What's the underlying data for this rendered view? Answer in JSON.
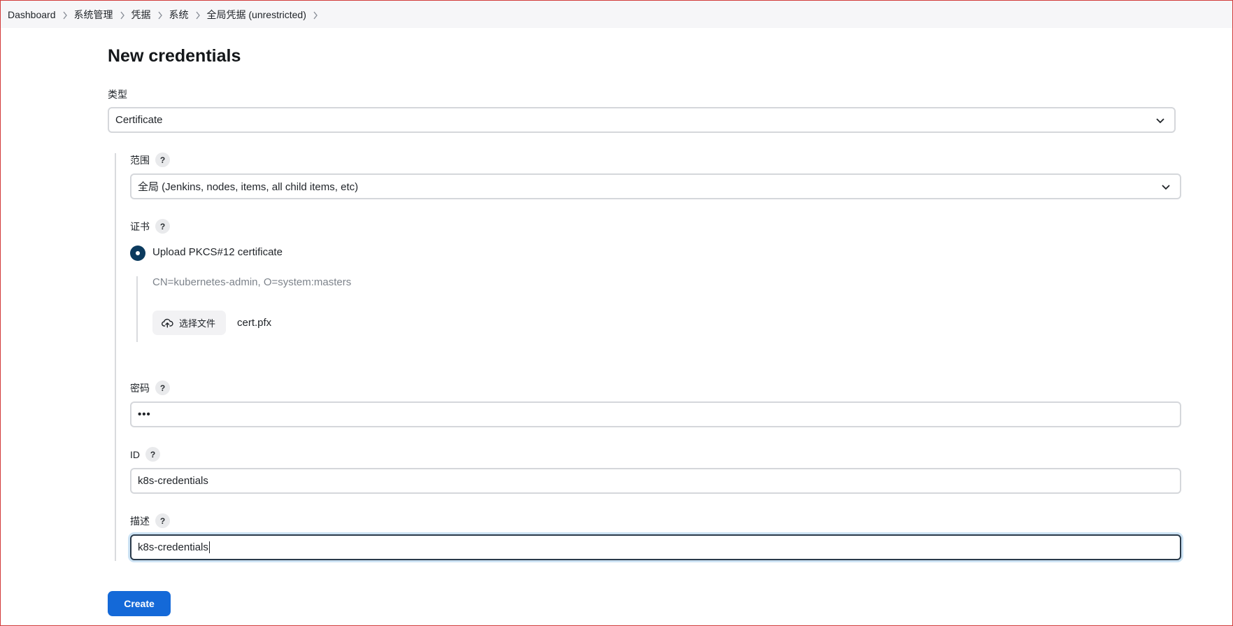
{
  "breadcrumb": [
    {
      "label": "Dashboard"
    },
    {
      "label": "系统管理"
    },
    {
      "label": "凭据"
    },
    {
      "label": "系统"
    },
    {
      "label": "全局凭据 (unrestricted)"
    }
  ],
  "page_title": "New credentials",
  "type_field": {
    "label": "类型",
    "value": "Certificate"
  },
  "scope_field": {
    "label": "范围",
    "help": "?",
    "value": "全局 (Jenkins, nodes, items, all child items, etc)"
  },
  "certificate_field": {
    "label": "证书",
    "help": "?",
    "option_label": "Upload PKCS#12 certificate",
    "option_selected": true,
    "cert_info": "CN=kubernetes-admin, O=system:masters",
    "choose_file_label": "选择文件",
    "file_name": "cert.pfx"
  },
  "password_field": {
    "label": "密码",
    "help": "?",
    "value": "•••"
  },
  "id_field": {
    "label": "ID",
    "help": "?",
    "value": "k8s-credentials"
  },
  "description_field": {
    "label": "描述",
    "help": "?",
    "value": "k8s-credentials"
  },
  "create_button": {
    "label": "Create"
  },
  "colors": {
    "primary": "#1469d8",
    "radio": "#0b3a5e",
    "focus_ring": "#cde3f4"
  },
  "icons": {
    "breadcrumb_separator": "chevron-right-icon",
    "select": "chevron-down-icon",
    "upload": "cloud-upload-icon"
  }
}
